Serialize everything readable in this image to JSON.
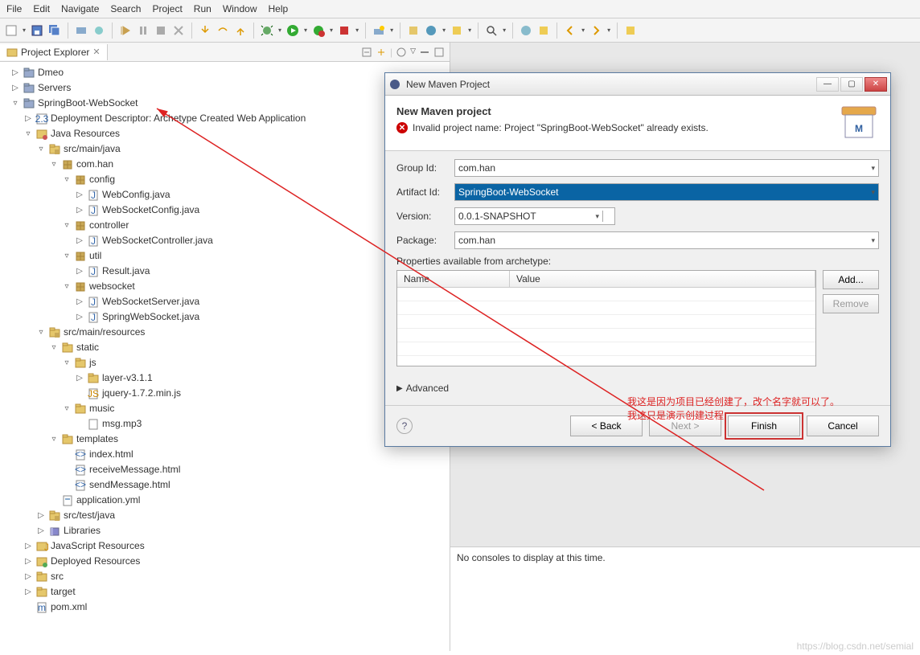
{
  "menubar": [
    "File",
    "Edit",
    "Navigate",
    "Search",
    "Project",
    "Run",
    "Window",
    "Help"
  ],
  "explorer": {
    "title": "Project Explorer",
    "tree": [
      {
        "depth": 0,
        "arrow": "▷",
        "icon": "proj",
        "label": "Dmeo"
      },
      {
        "depth": 0,
        "arrow": "▷",
        "icon": "proj",
        "label": "Servers"
      },
      {
        "depth": 0,
        "arrow": "▿",
        "icon": "proj",
        "label": "SpringBoot-WebSocket"
      },
      {
        "depth": 1,
        "arrow": "▷",
        "icon": "dd",
        "label": "Deployment Descriptor: Archetype Created Web Application"
      },
      {
        "depth": 1,
        "arrow": "▿",
        "icon": "jres",
        "label": "Java Resources"
      },
      {
        "depth": 2,
        "arrow": "▿",
        "icon": "srcfolder",
        "label": "src/main/java"
      },
      {
        "depth": 3,
        "arrow": "▿",
        "icon": "package",
        "label": "com.han"
      },
      {
        "depth": 4,
        "arrow": "▿",
        "icon": "package",
        "label": "config"
      },
      {
        "depth": 5,
        "arrow": "▷",
        "icon": "java",
        "label": "WebConfig.java"
      },
      {
        "depth": 5,
        "arrow": "▷",
        "icon": "java",
        "label": "WebSocketConfig.java"
      },
      {
        "depth": 4,
        "arrow": "▿",
        "icon": "package",
        "label": "controller"
      },
      {
        "depth": 5,
        "arrow": "▷",
        "icon": "java",
        "label": "WebSocketController.java"
      },
      {
        "depth": 4,
        "arrow": "▿",
        "icon": "package",
        "label": "util"
      },
      {
        "depth": 5,
        "arrow": "▷",
        "icon": "java",
        "label": "Result.java"
      },
      {
        "depth": 4,
        "arrow": "▿",
        "icon": "package",
        "label": "websocket"
      },
      {
        "depth": 5,
        "arrow": "▷",
        "icon": "java",
        "label": "WebSocketServer.java"
      },
      {
        "depth": 5,
        "arrow": "▷",
        "icon": "java",
        "label": "SpringWebSocket.java"
      },
      {
        "depth": 2,
        "arrow": "▿",
        "icon": "srcfolder",
        "label": "src/main/resources"
      },
      {
        "depth": 3,
        "arrow": "▿",
        "icon": "folder",
        "label": "static"
      },
      {
        "depth": 4,
        "arrow": "▿",
        "icon": "folder",
        "label": "js"
      },
      {
        "depth": 5,
        "arrow": "▷",
        "icon": "folder",
        "label": "layer-v3.1.1"
      },
      {
        "depth": 5,
        "arrow": "",
        "icon": "js",
        "label": "jquery-1.7.2.min.js"
      },
      {
        "depth": 4,
        "arrow": "▿",
        "icon": "folder",
        "label": "music"
      },
      {
        "depth": 5,
        "arrow": "",
        "icon": "file",
        "label": "msg.mp3"
      },
      {
        "depth": 3,
        "arrow": "▿",
        "icon": "folder",
        "label": "templates"
      },
      {
        "depth": 4,
        "arrow": "",
        "icon": "html",
        "label": "index.html"
      },
      {
        "depth": 4,
        "arrow": "",
        "icon": "html",
        "label": "receiveMessage.html"
      },
      {
        "depth": 4,
        "arrow": "",
        "icon": "html",
        "label": "sendMessage.html"
      },
      {
        "depth": 3,
        "arrow": "",
        "icon": "yml",
        "label": "application.yml"
      },
      {
        "depth": 2,
        "arrow": "▷",
        "icon": "srcfolder",
        "label": "src/test/java"
      },
      {
        "depth": 2,
        "arrow": "▷",
        "icon": "lib",
        "label": "Libraries"
      },
      {
        "depth": 1,
        "arrow": "▷",
        "icon": "jsres",
        "label": "JavaScript Resources"
      },
      {
        "depth": 1,
        "arrow": "▷",
        "icon": "depres",
        "label": "Deployed Resources"
      },
      {
        "depth": 1,
        "arrow": "▷",
        "icon": "folder",
        "label": "src"
      },
      {
        "depth": 1,
        "arrow": "▷",
        "icon": "folder",
        "label": "target"
      },
      {
        "depth": 1,
        "arrow": "",
        "icon": "xml",
        "label": "pom.xml"
      }
    ]
  },
  "dialog": {
    "title": "New Maven Project",
    "header_title": "New Maven project",
    "error_msg": "Invalid project name: Project \"SpringBoot-WebSocket\" already exists.",
    "labels": {
      "group": "Group Id:",
      "artifact": "Artifact Id:",
      "version": "Version:",
      "package": "Package:",
      "props": "Properties available from archetype:",
      "advanced": "Advanced"
    },
    "fields": {
      "group": "com.han",
      "artifact": "SpringBoot-WebSocket",
      "version": "0.0.1-SNAPSHOT",
      "package": "com.han"
    },
    "props_cols": {
      "name": "Name",
      "value": "Value"
    },
    "buttons": {
      "add": "Add...",
      "remove": "Remove",
      "back": "< Back",
      "next": "Next >",
      "finish": "Finish",
      "cancel": "Cancel"
    }
  },
  "console": {
    "text": "No consoles to display at this time."
  },
  "annotation": {
    "line1": "我这是因为项目已经创建了，改个名字就可以了。",
    "line2": "我这只是演示创建过程"
  },
  "watermark": "https://blog.csdn.net/semial"
}
